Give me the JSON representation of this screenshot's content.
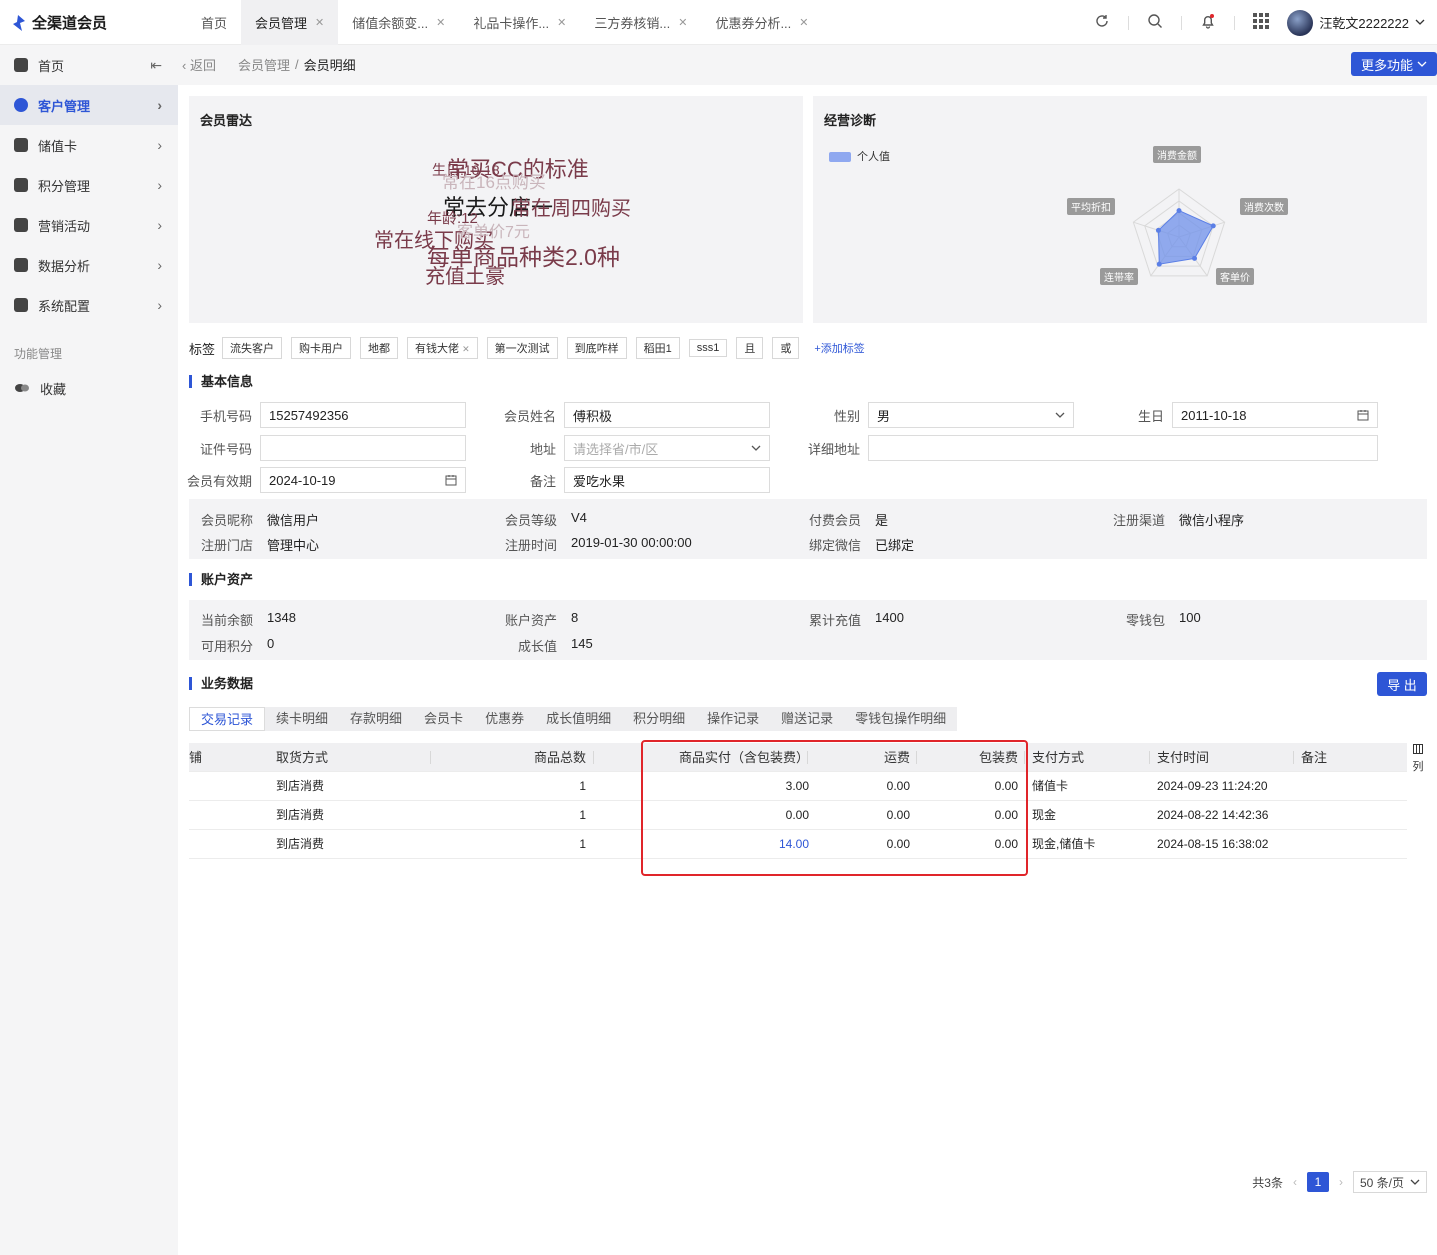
{
  "app": {
    "title": "全渠道会员"
  },
  "tabs": [
    {
      "label": "首页",
      "closable": false
    },
    {
      "label": "会员管理",
      "closable": true,
      "active": true
    },
    {
      "label": "储值余额变...",
      "closable": true
    },
    {
      "label": "礼品卡操作...",
      "closable": true
    },
    {
      "label": "三方券核销...",
      "closable": true
    },
    {
      "label": "优惠券分析...",
      "closable": true
    }
  ],
  "user": {
    "name": "汪乾文2222222"
  },
  "sidebar": {
    "items": [
      {
        "label": "首页",
        "icon": "home-icon",
        "collapse": "⇤"
      },
      {
        "label": "客户管理",
        "icon": "user-icon",
        "active": true
      },
      {
        "label": "储值卡",
        "icon": "card-icon"
      },
      {
        "label": "积分管理",
        "icon": "points-icon"
      },
      {
        "label": "营销活动",
        "icon": "campaign-icon"
      },
      {
        "label": "数据分析",
        "icon": "chart-icon"
      },
      {
        "label": "系统配置",
        "icon": "settings-icon"
      }
    ],
    "group_label": "功能管理",
    "favorites": "收藏"
  },
  "breadcrumb": {
    "back": "返回",
    "parent": "会员管理",
    "separator": "/",
    "current": "会员明细"
  },
  "more_button": "更多功能",
  "radar_card": {
    "title": "会员雷达",
    "words": [
      {
        "text": "常买CC的标准",
        "size": 22,
        "color": "#7a3b4a"
      },
      {
        "text": "生日:10-18",
        "size": 14,
        "color": "#7a3b4a"
      },
      {
        "text": "常在16点购买",
        "size": 17,
        "color": "#c9b5bb"
      },
      {
        "text": "常去分店一",
        "size": 22,
        "color": "#1a1a1a"
      },
      {
        "text": "常在周四购买",
        "size": 20,
        "color": "#7a3b4a"
      },
      {
        "text": "年龄:12",
        "size": 15,
        "color": "#7a3b4a"
      },
      {
        "text": "常在线下购买",
        "size": 20,
        "color": "#7a3b4a"
      },
      {
        "text": "客单价7元",
        "size": 16,
        "color": "#c9b5bb"
      },
      {
        "text": "每单商品种类2.0种",
        "size": 23,
        "color": "#7a3b4a"
      },
      {
        "text": "充值土豪",
        "size": 20,
        "color": "#7a3b4a"
      }
    ]
  },
  "diagnosis_card": {
    "title": "经营诊断",
    "legend": "个人值",
    "axes": [
      "消费金额",
      "消费次数",
      "客单价",
      "连带率",
      "平均折扣"
    ],
    "values": [
      0.55,
      0.75,
      0.55,
      0.7,
      0.45
    ],
    "color": "#6f90ea"
  },
  "tags": {
    "label": "标签",
    "items": [
      "流失客户",
      "购卡用户",
      "地都",
      "有钱大佬",
      "第一次测试",
      "到底咋样",
      "稻田1",
      "sss1",
      "且",
      "或"
    ],
    "closable_index": 3,
    "add": "+添加标签"
  },
  "basic_info": {
    "title": "基本信息",
    "phone": {
      "label": "手机号码",
      "value": "15257492356"
    },
    "name": {
      "label": "会员姓名",
      "value": "傅积极"
    },
    "gender": {
      "label": "性别",
      "value": "男"
    },
    "birthday": {
      "label": "生日",
      "value": "2011-10-18"
    },
    "id_no": {
      "label": "证件号码",
      "value": ""
    },
    "address": {
      "label": "地址",
      "placeholder": "请选择省/市/区"
    },
    "detail_address": {
      "label": "详细地址",
      "value": ""
    },
    "validity": {
      "label": "会员有效期",
      "value": "2024-10-19"
    },
    "remark": {
      "label": "备注",
      "value": "爱吃水果"
    }
  },
  "member_meta": [
    {
      "label": "会员昵称",
      "value": "微信用户"
    },
    {
      "label": "会员等级",
      "value": "V4"
    },
    {
      "label": "付费会员",
      "value": "是"
    },
    {
      "label": "注册渠道",
      "value": "微信小程序"
    },
    {
      "label": "注册门店",
      "value": "管理中心"
    },
    {
      "label": "注册时间",
      "value": "2019-01-30 00:00:00"
    },
    {
      "label": "绑定微信",
      "value": "已绑定"
    }
  ],
  "assets": {
    "title": "账户资产",
    "items": [
      {
        "label": "当前余额",
        "value": "1348"
      },
      {
        "label": "账户资产",
        "value": "8"
      },
      {
        "label": "累计充值",
        "value": "1400"
      },
      {
        "label": "零钱包",
        "value": "100"
      },
      {
        "label": "可用积分",
        "value": "0"
      },
      {
        "label": "成长值",
        "value": "145"
      }
    ]
  },
  "business": {
    "title": "业务数据",
    "export": "导 出",
    "subtabs": [
      "交易记录",
      "续卡明细",
      "存款明细",
      "会员卡",
      "优惠券",
      "成长值明细",
      "积分明细",
      "操作记录",
      "赠送记录",
      "零钱包操作明细"
    ],
    "columns": [
      "铺",
      "取货方式",
      "商品总数",
      "商品实付（含包装费）",
      "运费",
      "包装费",
      "支付方式",
      "支付时间",
      "备注"
    ],
    "rows": [
      [
        "",
        "到店消费",
        "1",
        "3.00",
        "0.00",
        "0.00",
        "储值卡",
        "2024-09-23 11:24:20",
        ""
      ],
      [
        "",
        "到店消费",
        "1",
        "0.00",
        "0.00",
        "0.00",
        "现金",
        "2024-08-22 14:42:36",
        ""
      ],
      [
        "",
        "到店消费",
        "1",
        "14.00",
        "0.00",
        "0.00",
        "现金,储值卡",
        "2024-08-15 16:38:02",
        ""
      ]
    ],
    "column_settings": "列",
    "link_color": "#2e56d6"
  },
  "pagination": {
    "total": "共3条",
    "current": "1",
    "page_size": "50 条/页"
  }
}
